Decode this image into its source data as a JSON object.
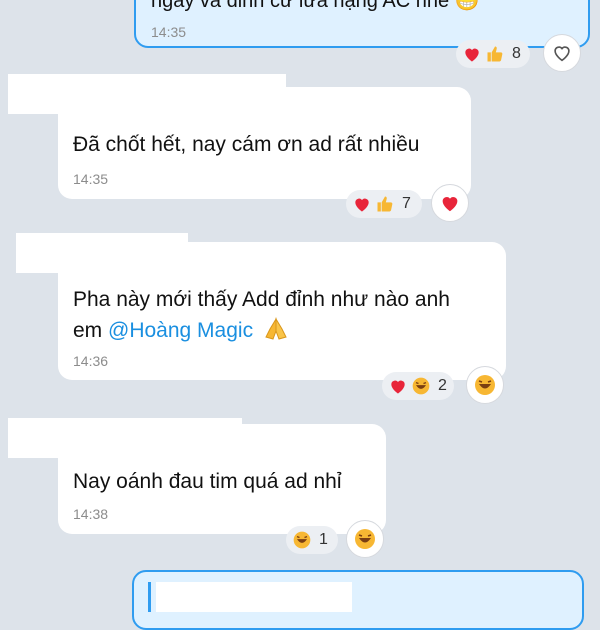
{
  "messages": [
    {
      "id": "m0",
      "text": "ngày và đỉnh cư lừa hạng AC nhé 😁",
      "time": "14:35",
      "reaction_count": "8",
      "own": true
    },
    {
      "id": "m1",
      "text": "Đã chốt hết, nay cám ơn ad rất nhiều",
      "time": "14:35",
      "reaction_count": "7"
    },
    {
      "id": "m2",
      "text_line1": "Pha này mới thấy Add đỉnh như nào anh",
      "text_line2_prefix": "em ",
      "mention": "@Hoàng Magic",
      "time": "14:36",
      "reaction_count": "2"
    },
    {
      "id": "m3",
      "text": "Nay oánh đau tim quá ad nhỉ",
      "time": "14:38",
      "reaction_count": "1"
    }
  ],
  "colors": {
    "background": "#dde3ea",
    "own_bubble_border": "#2f9cf0",
    "own_bubble_fill": "#dff1ff",
    "mention": "#1a8fe0",
    "heart": "#e8253a"
  },
  "icons": {
    "heart": "heart-icon",
    "like": "thumbs-up-icon",
    "haha": "laughing-face-icon",
    "pray": "praying-hands-icon",
    "heart_outline": "heart-outline-icon"
  }
}
